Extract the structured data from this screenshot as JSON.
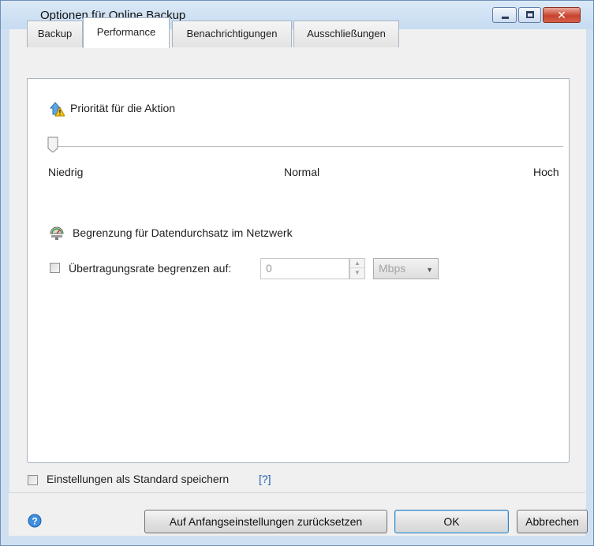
{
  "window": {
    "title": "Optionen für Online Backup",
    "controls": {
      "minimize": "minimize-icon",
      "maximize": "maximize-icon",
      "close_glyph": "✕"
    }
  },
  "tabs": [
    {
      "label": "Backup",
      "active": false
    },
    {
      "label": "Performance",
      "active": true
    },
    {
      "label": "Benachrichtigungen",
      "active": false
    },
    {
      "label": "Ausschließungen",
      "active": false
    }
  ],
  "priority": {
    "icon": "priority-warning-icon",
    "heading": "Priorität für die Aktion",
    "slider_value": 0,
    "levels": [
      "Niedrig",
      "Normal",
      "Hoch"
    ]
  },
  "network": {
    "icon": "network-throughput-icon",
    "heading": "Begrenzung für Datendurchsatz im Netzwerk",
    "limit_checkbox_label": "Übertragungsrate begrenzen auf:",
    "limit_checked": false,
    "rate_value": "0",
    "unit": "Mbps"
  },
  "footer": {
    "default_checkbox_label": "Einstellungen als Standard speichern",
    "default_checked": false,
    "help_link": "[?]",
    "reset_label": "Auf Anfangseinstellungen zurücksetzen",
    "ok_label": "OK",
    "cancel_label": "Abbrechen"
  },
  "colors": {
    "accent": "#1b5fb5",
    "window_frame": "#cfe0f2"
  }
}
